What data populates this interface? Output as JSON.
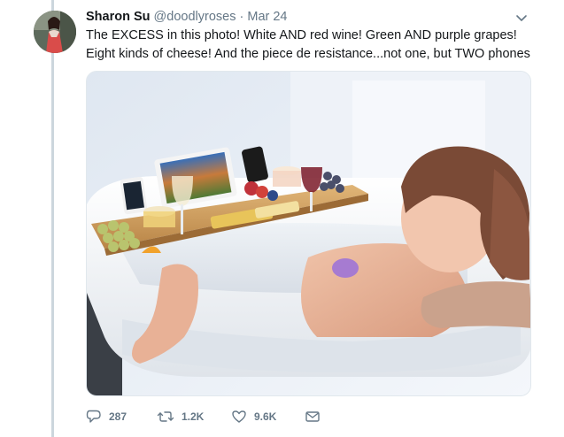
{
  "tweet": {
    "author_name": "Sharon Su",
    "handle": "@doodlyroses",
    "separator": "·",
    "date": "Mar 24",
    "text": "The EXCESS in this photo! White AND red wine! Green AND purple grapes! Eight kinds of cheese! And the piece de resistance...not one, but TWO phones"
  },
  "actions": {
    "replies": "287",
    "retweets": "1.2K",
    "likes": "9.6K"
  },
  "icons": {
    "caret": "chevron-down-icon",
    "reply": "reply-icon",
    "retweet": "retweet-icon",
    "like": "heart-icon",
    "message": "envelope-icon"
  },
  "colors": {
    "text": "#14171a",
    "secondary": "#657786",
    "thread_line": "#ccd6dd"
  }
}
